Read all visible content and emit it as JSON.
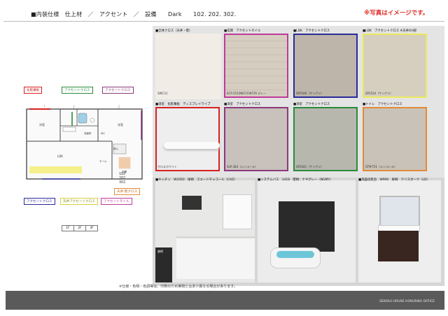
{
  "header": {
    "title": "■内装仕様　仕上材　／　アクセント　／　設備　　Dark　　102. 202. 302.",
    "note": "※写真はイメージです。"
  },
  "plan": {
    "tags_top": [
      "化粧幕板",
      "アクセントクロス",
      "アクセントクロス"
    ],
    "tags_bottom": [
      "アクセントクロス",
      "天井アクセントクロス",
      "アクセントタイル"
    ],
    "tag_right": "天井:壁クロス",
    "rooms": {
      "western1": "洋室",
      "western2": "洋室",
      "ldk": "LDK",
      "entrance": "玄関",
      "closet": "物入",
      "bath": "洗面所",
      "wc": "WC",
      "balcony": "ホール"
    },
    "unit_numbers": [
      "102",
      "202",
      "302"
    ],
    "floor_buttons": [
      "1F",
      "2F",
      "3F"
    ]
  },
  "swatches": [
    {
      "label": "■全体クロス（天井・壁）",
      "name": "SWC31",
      "color": "#f1ede6",
      "border": ""
    },
    {
      "label": "■玄関　アクセントタイル",
      "name": "ECP-2515NET/CW576 グレー",
      "color": "#d8cfc4",
      "border": "#c0399a"
    },
    {
      "label": "■LDK　アクセントクロス",
      "name": "SP2546（サンゲツ）",
      "color": "#bdb5a9",
      "border": "#2a2a9a"
    },
    {
      "label": "■LDK　アクセントクロス ※天井OH部",
      "name": "SP2520（サンゲツ）",
      "color": "#d6cfc0",
      "border": "#eaea5a"
    },
    {
      "label": "■洋室　化粧幕板　ディスプレイライプ",
      "name": "グロスホワイト",
      "color": "#eeeeee",
      "border": "#d82020"
    },
    {
      "label": "■洋室　アクセントクロス",
      "name": "SLP-383（シンコール）",
      "color": "#c9c1bb",
      "border": "#8a3a7a"
    },
    {
      "label": "■洋室　アクセントクロス",
      "name": "SP2541（サンゲツ）",
      "color": "#b7b7ae",
      "border": "#2b8a3a"
    },
    {
      "label": "■トイレ　アクセントクロス",
      "name": "STM-T51（シンコール）",
      "color": "#c9c2b8",
      "border": "#e28a3a"
    }
  ],
  "photos": [
    {
      "label": "■キッチン　W2450　扉柄　スエードチャコール（CAZ）",
      "door_tag": "扉柄"
    },
    {
      "label": "■システムバス　1418　壁柄：ナギグレー（NGMY）"
    },
    {
      "label": "■洗面化粧台　W900　扉柄　クリスダーク（LD）"
    }
  ],
  "footer": {
    "note": "※仕様・色柄・色調等は、印刷のため実物とは多少異なる場合があります。",
    "brand": "SEKISUI HOUSE HOKURIKU OFFICE"
  }
}
